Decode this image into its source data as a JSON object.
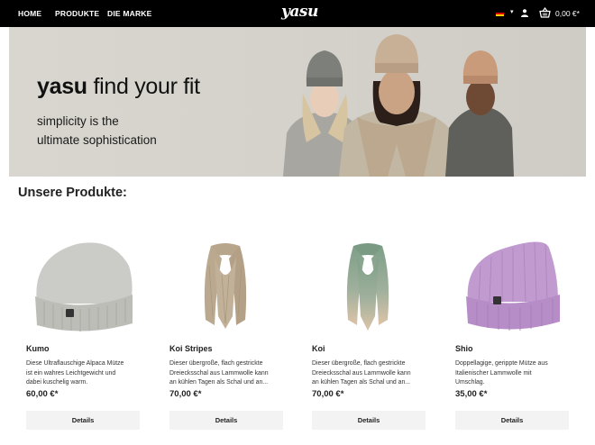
{
  "header": {
    "nav": [
      "HOME",
      "PRODUKTE",
      "DIE MARKE"
    ],
    "logo": "yasu",
    "language_flag": "de-flag-icon",
    "user_icon": "user-icon",
    "cart_icon": "basket-icon",
    "cart_total": "0,00 €*"
  },
  "hero": {
    "brand": "yasu",
    "headline_rest": "find your fit",
    "subline_1": "simplicity is the",
    "subline_2": "ultimate sophistication"
  },
  "section_title": "Unsere Produkte:",
  "products": [
    {
      "name": "Kumo",
      "desc_1": "Diese Ultraflauschige Alpaca Mütze",
      "desc_2": "ist ein wahres Leichtgewicht und",
      "desc_3": "dabei kuschelig warm.",
      "price": "60,00 €*",
      "button": "Details",
      "color": "#c9c9c5"
    },
    {
      "name": "Koi Stripes",
      "desc_1": "Dieser übergroße, flach gestrickte",
      "desc_2": "Dreiecksschal aus Lammwolle kann",
      "desc_3": "an kühlen Tagen als Schal und an...",
      "price": "70,00 €*",
      "button": "Details",
      "color": "#b8a58c"
    },
    {
      "name": "Koi",
      "desc_1": "Dieser übergroße, flach gestrickte",
      "desc_2": "Dreiecksschal aus Lammwolle kann",
      "desc_3": "an kühlen Tagen als Schal und an...",
      "price": "70,00 €*",
      "button": "Details",
      "color": "#7f9e88"
    },
    {
      "name": "Shio",
      "desc_1": "Doppellagige, gerippte Mütze aus",
      "desc_2": "Italienischer Lammwolle mit",
      "desc_3": "Umschlag.",
      "price": "35,00 €*",
      "button": "Details",
      "color": "#b98fc4"
    }
  ]
}
